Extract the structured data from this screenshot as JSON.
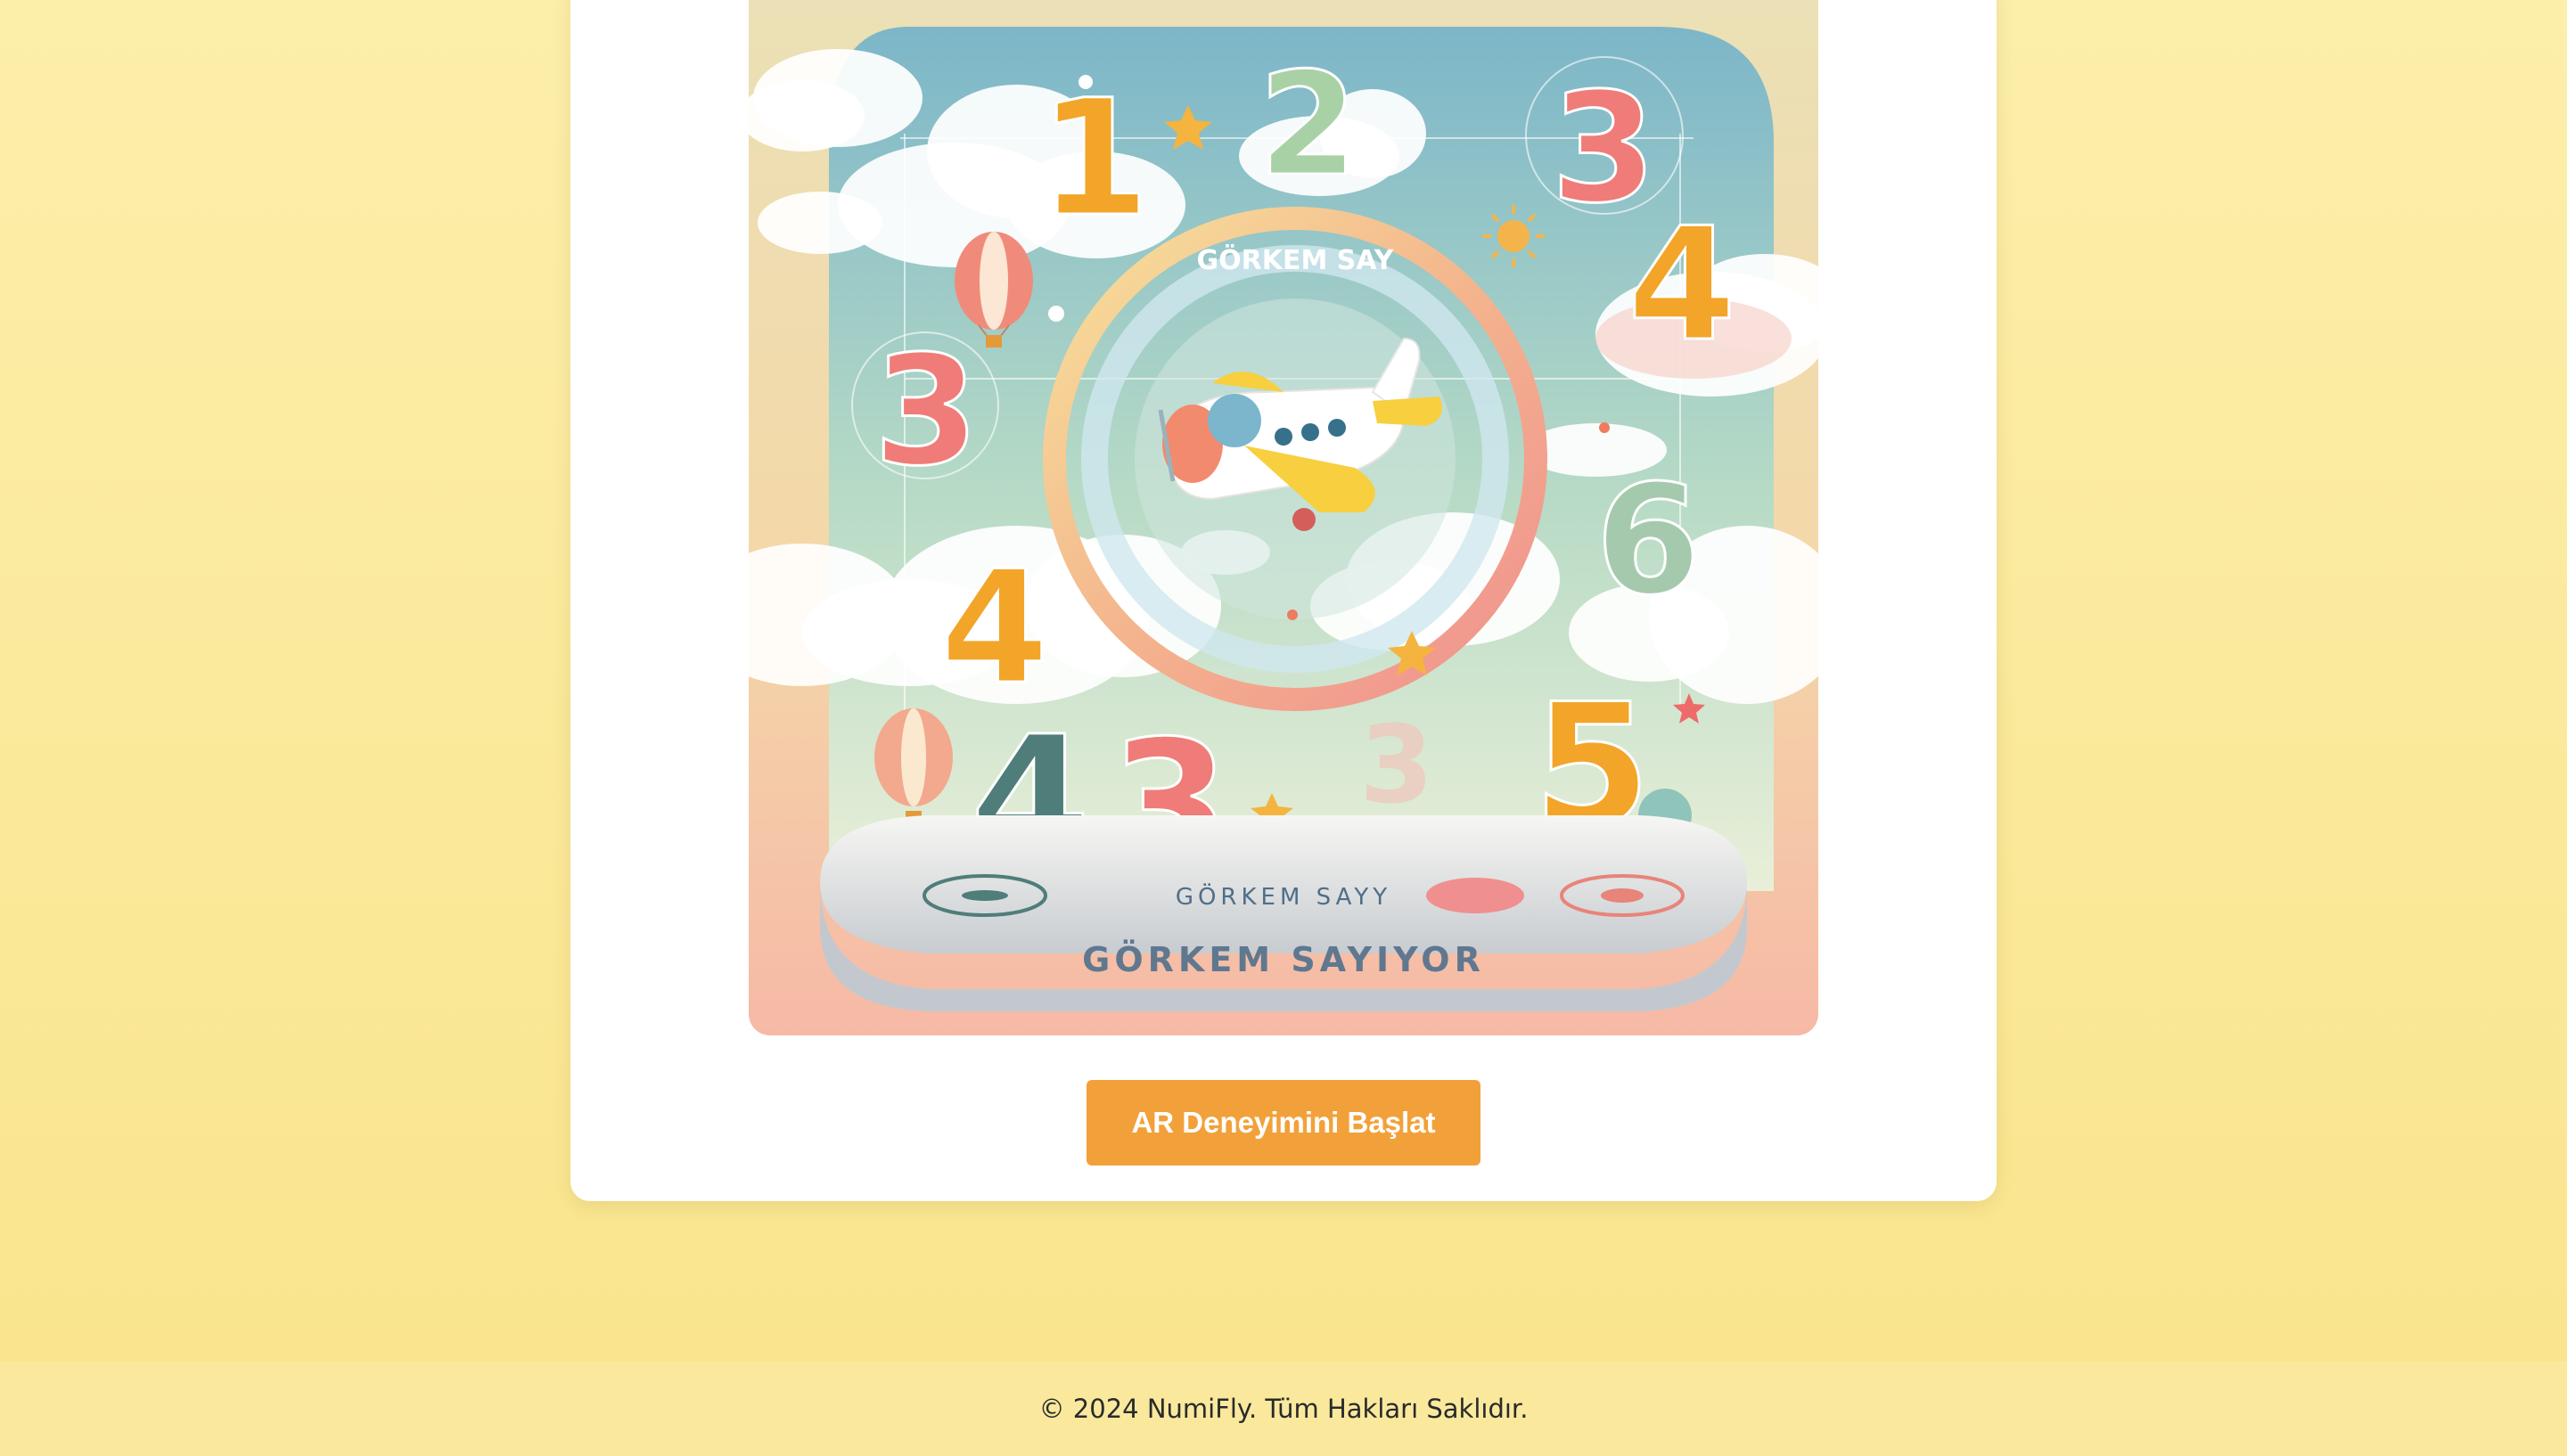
{
  "poster": {
    "image_alt": "Görkem Sayıyor",
    "digits": [
      "1",
      "2",
      "3",
      "3",
      "4",
      "4",
      "6",
      "4",
      "3",
      "5",
      "3"
    ],
    "ring_text": "GÖRKEM SAY",
    "base_small_text": "GÖRKEM SAYY",
    "base_title": "GÖRKEM SAYIYOR"
  },
  "main": {
    "ar_button_label": "AR Deneyimini Başlat"
  },
  "footer": {
    "copyright": "© 2024 NumiFly. Tüm Hakları Saklıdır."
  },
  "colors": {
    "background": "#fcefaa",
    "card": "#ffffff",
    "button": "#f2a13a",
    "footer": "#fae99d"
  }
}
